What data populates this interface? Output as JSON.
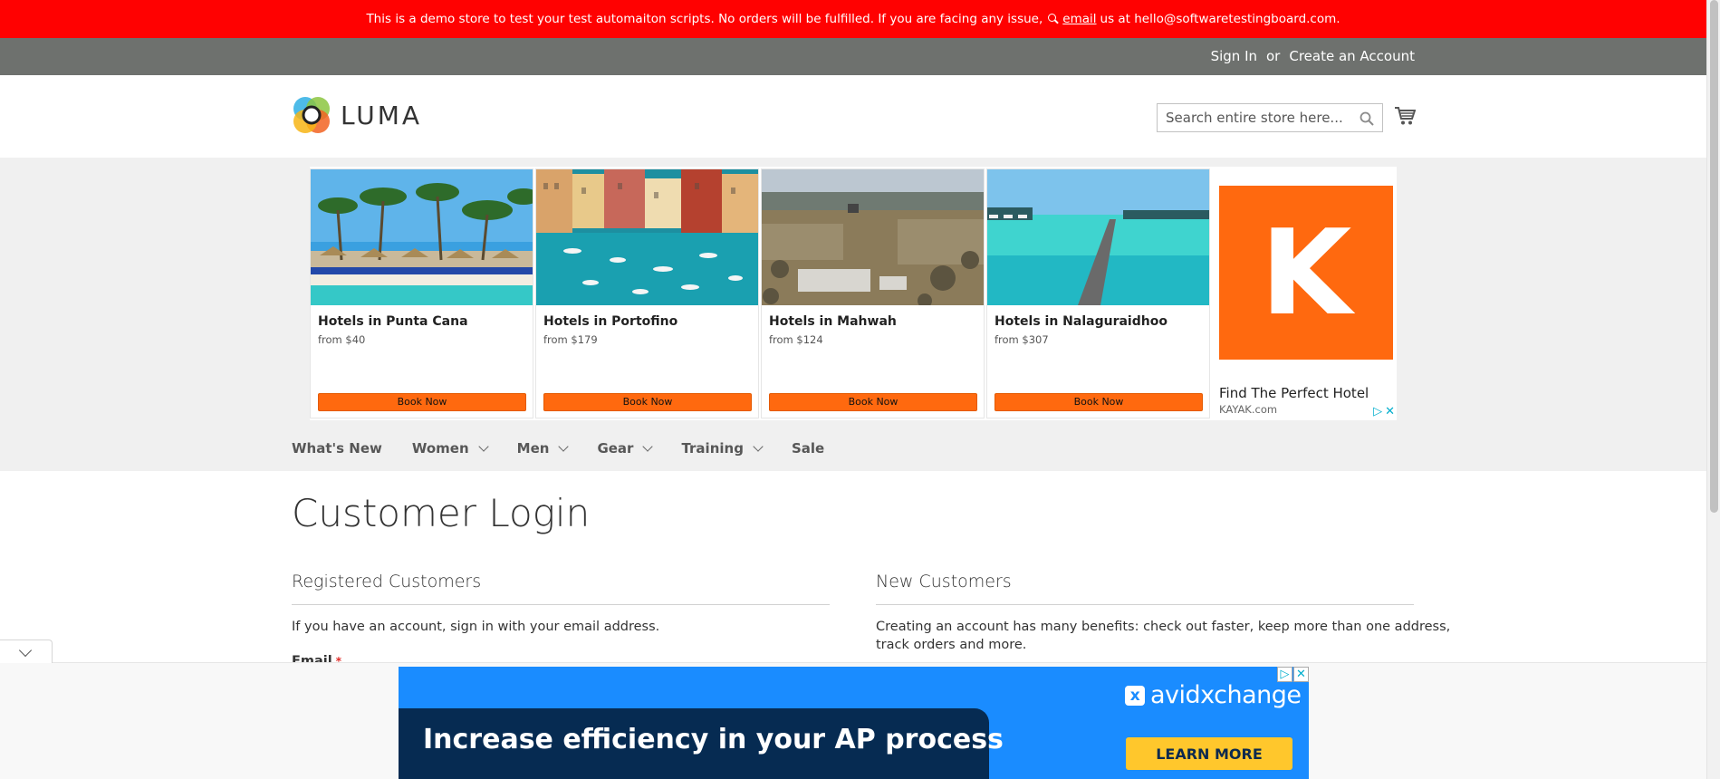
{
  "demo_banner": {
    "text_before": "This is a demo store to test your test automaiton scripts. No orders will be fulfilled. If you are facing any issue,",
    "email_link": "email",
    "text_after": "us at hello@softwaretestingboard.com."
  },
  "top_links": {
    "sign_in": "Sign In",
    "or": "or",
    "create_account": "Create an Account"
  },
  "header": {
    "logo_text": "LUMA",
    "search_placeholder": "Search entire store here...",
    "search_value": ""
  },
  "ad": {
    "hotels": [
      {
        "name": "Hotels in Punta Cana",
        "price": "from $40",
        "button": "Book Now"
      },
      {
        "name": "Hotels in Portofino",
        "price": "from $179",
        "button": "Book Now"
      },
      {
        "name": "Hotels in Mahwah",
        "price": "from $124",
        "button": "Book Now"
      },
      {
        "name": "Hotels in Nalaguraidhoo",
        "price": "from $307",
        "button": "Book Now"
      }
    ],
    "kayak": {
      "logo_letter": "K",
      "title": "Find The Perfect Hotel",
      "domain": "KAYAK.com"
    }
  },
  "nav": {
    "items": [
      {
        "label": "What's New"
      },
      {
        "label": "Women"
      },
      {
        "label": "Men"
      },
      {
        "label": "Gear"
      },
      {
        "label": "Training"
      },
      {
        "label": "Sale"
      }
    ]
  },
  "main": {
    "page_title": "Customer Login",
    "registered": {
      "title": "Registered Customers",
      "note": "If you have an account, sign in with your email address.",
      "email_label": "Email",
      "required_mark": "*"
    },
    "new_customers": {
      "title": "New Customers",
      "note_line1": "Creating an account has many benefits: check out faster, keep more than one address,",
      "note_line2": "track orders and more."
    }
  },
  "bottom_ad": {
    "headline": "Increase efficiency in your AP process",
    "brand": "avidxchange",
    "brand_mark": "x",
    "cta": "LEARN MORE"
  },
  "colors": {
    "demo_banner": "#ff0101",
    "header_bar": "#6e716e",
    "book_button": "#ff690f",
    "kayak_orange": "#ff690f",
    "bottom_ad_blue": "#1a8cff",
    "cta_yellow": "#ffc72c"
  }
}
